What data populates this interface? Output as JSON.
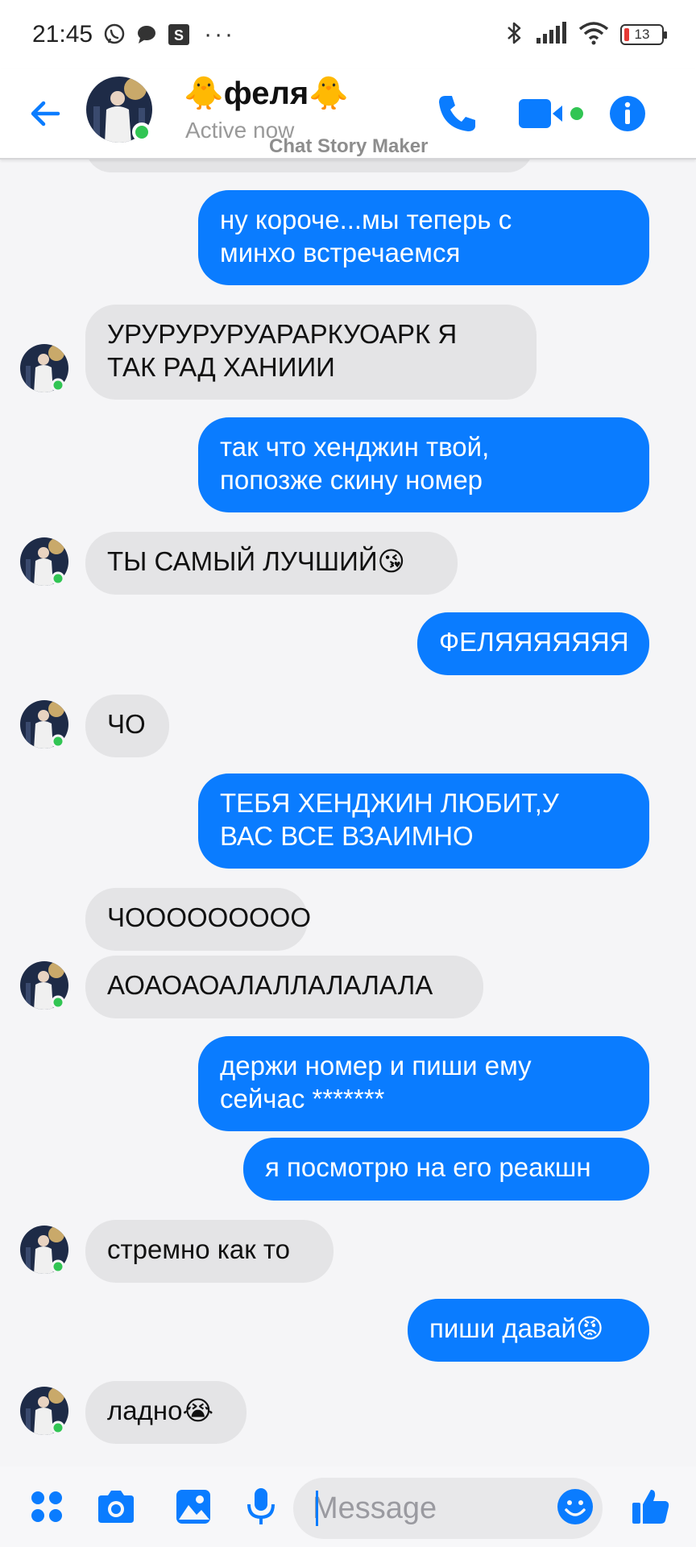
{
  "status_bar": {
    "time": "21:45",
    "icons": [
      "viber-icon",
      "chat-icon",
      "s-app-icon"
    ],
    "dots": "···",
    "battery_level": "13",
    "battery_color": "#e53935"
  },
  "header": {
    "contact_name": "🐥феля🐥",
    "status": "Active now",
    "watermark": "Chat Story Maker",
    "accent_color": "#0a7cff",
    "online_color": "#31c553"
  },
  "messages": [
    {
      "side": "out",
      "lines": [
        "ну короче...мы теперь с",
        "минхо встречаемся"
      ]
    },
    {
      "side": "in",
      "lines": [
        "УРУРУРУРУАРАРКУОАРК Я",
        "ТАК РАД ХАНИИИ"
      ]
    },
    {
      "side": "out",
      "lines": [
        "так что хенджин твой,",
        "попозже скину номер"
      ]
    },
    {
      "side": "in",
      "text": "ТЫ САМЫЙ ЛУЧШИЙ",
      "emoji": "😘"
    },
    {
      "side": "out",
      "text": "ФЕЛЯЯЯЯЯЯЯ"
    },
    {
      "side": "in",
      "text": "ЧО"
    },
    {
      "side": "out",
      "lines": [
        "ТЕБЯ ХЕНДЖИН ЛЮБИТ,У",
        "ВАС ВСЕ ВЗАИМНО"
      ]
    },
    {
      "side": "in",
      "text": "ЧООООООООО"
    },
    {
      "side": "in",
      "text": "АОАОАОАЛАЛЛАЛАЛАЛА"
    },
    {
      "side": "out",
      "lines": [
        "держи номер и пиши ему",
        "сейчас *******"
      ]
    },
    {
      "side": "out",
      "text": "я посмотрю на его реакшн"
    },
    {
      "side": "in",
      "text": "стремно как то"
    },
    {
      "side": "out",
      "text": "пиши давай",
      "emoji": "😡"
    },
    {
      "side": "in",
      "text": "ладно",
      "emoji": "😭"
    }
  ],
  "composer": {
    "placeholder": "Message",
    "icons": [
      "apps-icon",
      "camera-icon",
      "gallery-icon",
      "microphone-icon",
      "emoji-icon",
      "thumbs-up-icon"
    ]
  }
}
